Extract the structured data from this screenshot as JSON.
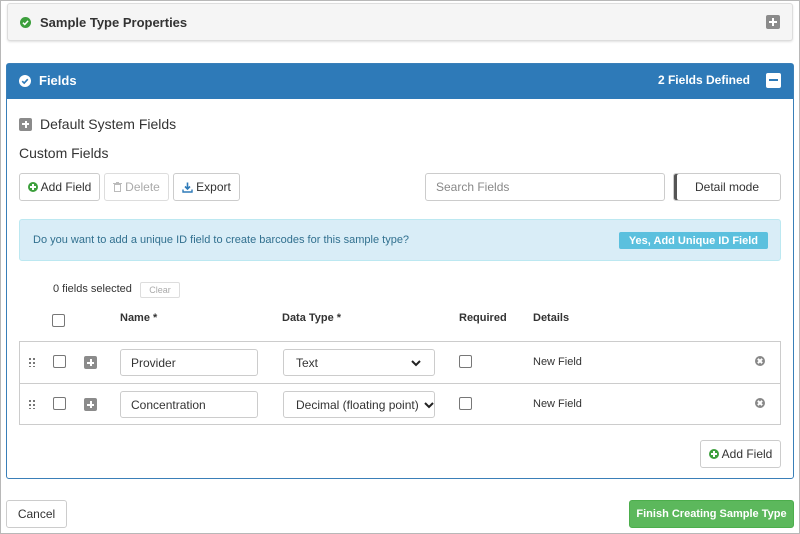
{
  "panel_sample_type": {
    "title": "Sample Type Properties"
  },
  "panel_fields": {
    "title": "Fields",
    "count_text": "2 Fields Defined",
    "default_system_fields": "Default System Fields",
    "custom_fields": "Custom Fields"
  },
  "toolbar": {
    "add_field": "Add Field",
    "delete": "Delete",
    "export": "Export",
    "search_placeholder": "Search Fields",
    "detail_mode": "Detail mode"
  },
  "alert": {
    "message": "Do you want to add a unique ID field to create barcodes for this sample type?",
    "action": "Yes, Add Unique ID Field"
  },
  "selection": {
    "count_text": "0 fields selected",
    "clear": "Clear"
  },
  "table": {
    "headers": {
      "name": "Name *",
      "data_type": "Data Type *",
      "required": "Required",
      "details": "Details"
    },
    "rows": [
      {
        "name": "Provider",
        "data_type": "Text",
        "required": false,
        "details": "New Field"
      },
      {
        "name": "Concentration",
        "data_type": "Decimal (floating point)",
        "required": false,
        "details": "New Field"
      }
    ]
  },
  "bottom_add_field": "Add Field",
  "footer": {
    "cancel": "Cancel",
    "finish": "Finish Creating Sample Type"
  },
  "colors": {
    "primary": "#2e7ab8",
    "success": "#5cb85c",
    "info": "#5bc0de",
    "info_bg": "#d9edf7"
  }
}
